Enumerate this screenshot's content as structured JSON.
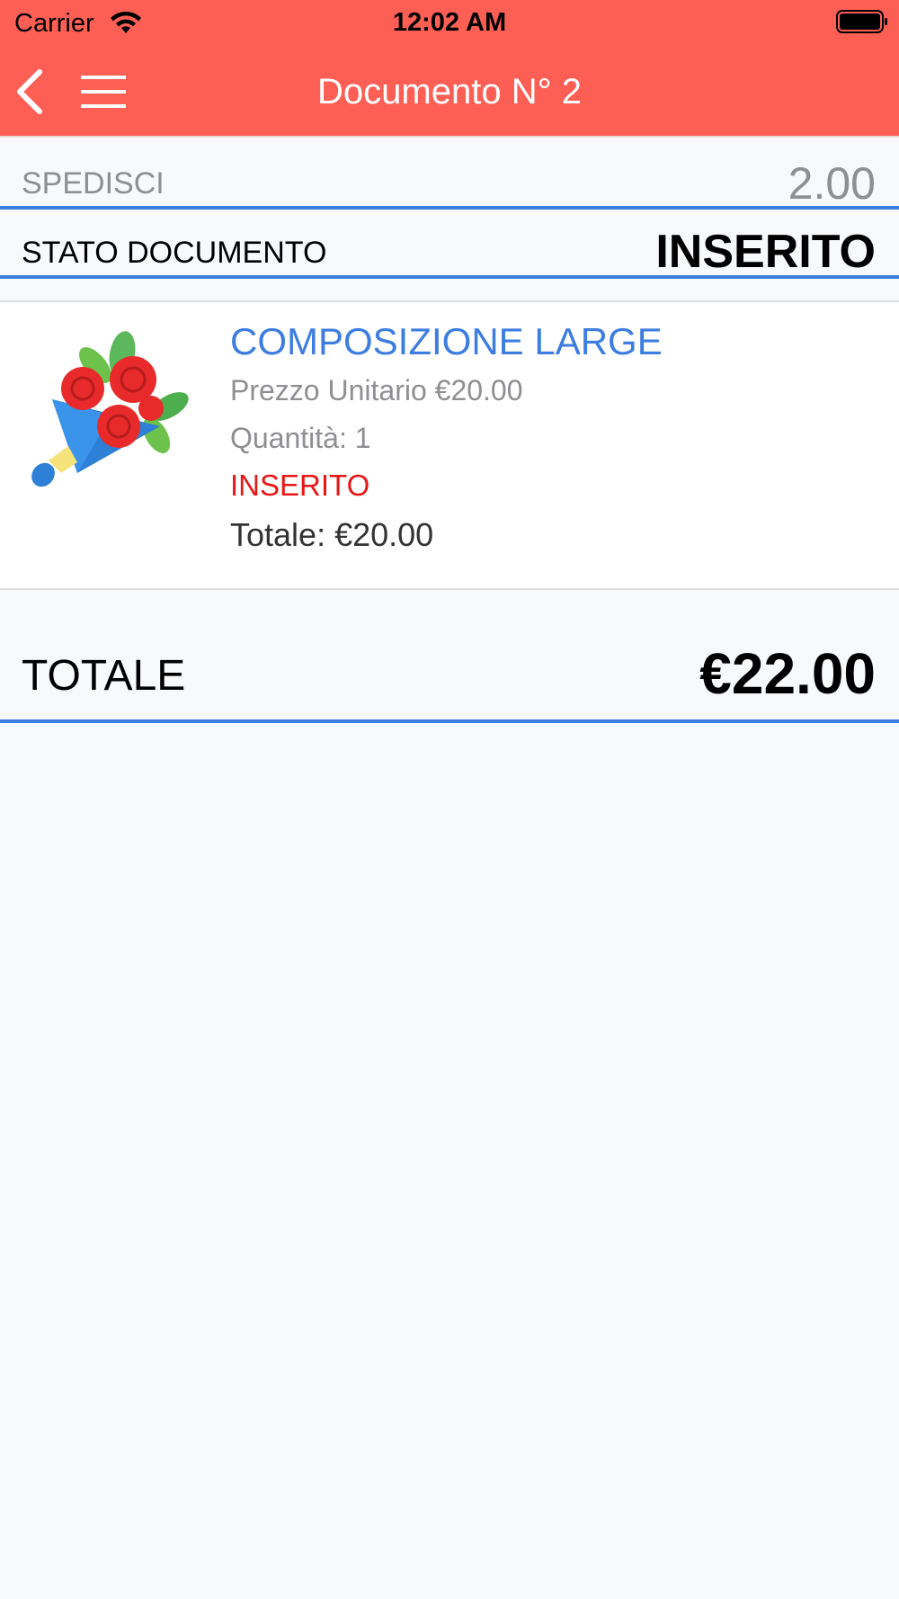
{
  "status_bar": {
    "carrier": "Carrier",
    "time": "12:02 AM",
    "wifi_icon": "wifi-icon",
    "battery_icon": "battery-icon"
  },
  "nav": {
    "title": "Documento N° 2",
    "back_icon": "chevron-left-icon",
    "menu_icon": "hamburger-menu-icon"
  },
  "summary": {
    "shipping_label": "SPEDISCI",
    "shipping_value": "2.00",
    "status_label": "STATO DOCUMENTO",
    "status_value": "INSERITO"
  },
  "items": [
    {
      "name": "COMPOSIZIONE LARGE",
      "unit_price": "Prezzo Unitario €20.00",
      "quantity": "Quantità: 1",
      "status": "INSERITO",
      "total": "Totale: €20.00",
      "image_icon": "flower-bouquet-icon"
    }
  ],
  "total": {
    "label": "TOTALE",
    "value": "€22.00"
  },
  "colors": {
    "header_bg": "#fe5f55",
    "accent_blue": "#3d7de0",
    "status_red": "#e81616",
    "muted_gray": "#8e8e93",
    "page_bg": "#f8f9fb"
  }
}
